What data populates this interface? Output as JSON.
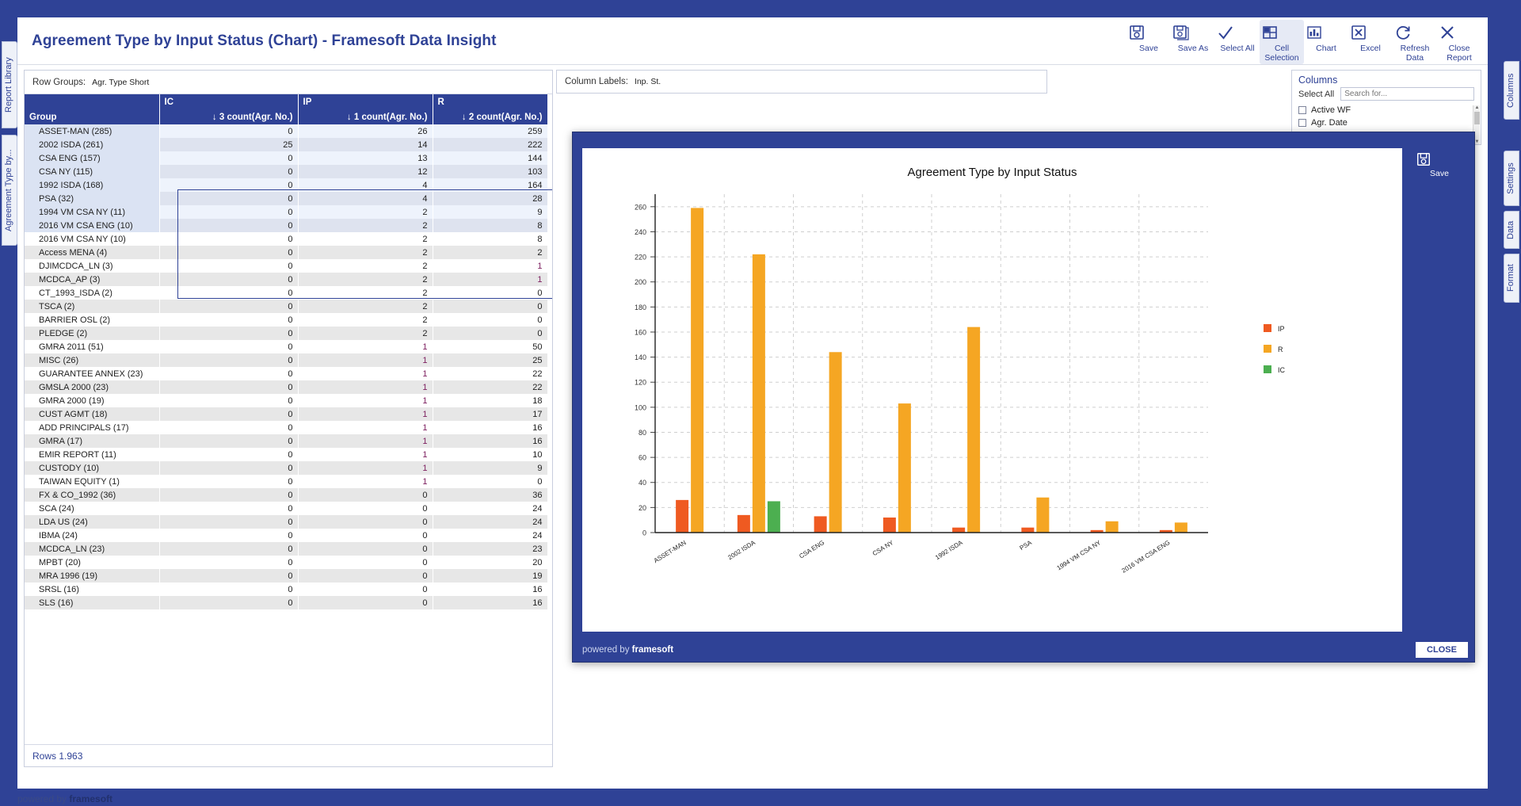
{
  "window": {
    "title": "Agreement Type by Input Status (Chart) - Framesoft Data Insight",
    "footer_powered": "powered by ",
    "footer_brand": "framesoft"
  },
  "vertical_tabs": {
    "left": [
      {
        "label": "Report Library"
      },
      {
        "label": "Agreement Type by..."
      }
    ],
    "right": [
      {
        "label": "Columns"
      },
      {
        "label": "Settings"
      },
      {
        "label": "Data"
      },
      {
        "label": "Format"
      }
    ]
  },
  "toolbar": [
    {
      "label": "Save",
      "icon": "save-icon",
      "active": false
    },
    {
      "label": "Save As",
      "icon": "save-as-icon",
      "active": false
    },
    {
      "label": "Select All",
      "icon": "check-icon",
      "active": false
    },
    {
      "label": "Cell Selection",
      "icon": "grid-icon",
      "active": true
    },
    {
      "label": "Chart",
      "icon": "chart-icon",
      "active": false
    },
    {
      "label": "Excel",
      "icon": "excel-icon",
      "active": false
    },
    {
      "label": "Refresh Data",
      "icon": "refresh-icon",
      "active": false
    },
    {
      "label": "Close Report",
      "icon": "close-icon",
      "active": false
    }
  ],
  "row_groups": {
    "label": "Row Groups:",
    "value": "Agr. Type Short"
  },
  "column_labels": {
    "label": "Column Labels:",
    "value": "Inp. St."
  },
  "columns_panel": {
    "title": "Columns",
    "select_all": "Select All",
    "search_placeholder": "Search for...",
    "items": [
      {
        "label": "Active WF",
        "checked": false
      },
      {
        "label": "Agr. Date",
        "checked": false
      }
    ]
  },
  "grid": {
    "group_headers": [
      "",
      "IC",
      "IP",
      "R"
    ],
    "sub_headers": [
      "Group",
      "↓ 3 count(Agr. No.)",
      "↓ 1 count(Agr. No.)",
      "↓ 2 count(Agr. No.)"
    ],
    "footer": "Rows 1.963",
    "selection": {
      "start_row": 0,
      "end_row": 7
    },
    "rows": [
      {
        "name": "ASSET-MAN (285)",
        "ic": "0",
        "ip": "26",
        "r": "259",
        "sel": true,
        "r_red": false,
        "ip_red": false
      },
      {
        "name": "2002 ISDA (261)",
        "ic": "25",
        "ip": "14",
        "r": "222",
        "sel": true,
        "r_red": false,
        "ip_red": false
      },
      {
        "name": "CSA ENG (157)",
        "ic": "0",
        "ip": "13",
        "r": "144",
        "sel": true,
        "r_red": false,
        "ip_red": false
      },
      {
        "name": "CSA NY (115)",
        "ic": "0",
        "ip": "12",
        "r": "103",
        "sel": true,
        "r_red": false,
        "ip_red": false
      },
      {
        "name": "1992 ISDA (168)",
        "ic": "0",
        "ip": "4",
        "r": "164",
        "sel": true,
        "r_red": false,
        "ip_red": false
      },
      {
        "name": "PSA (32)",
        "ic": "0",
        "ip": "4",
        "r": "28",
        "sel": true,
        "r_red": false,
        "ip_red": false
      },
      {
        "name": "1994 VM CSA NY (11)",
        "ic": "0",
        "ip": "2",
        "r": "9",
        "sel": true,
        "r_red": false,
        "ip_red": false
      },
      {
        "name": "2016 VM CSA ENG (10)",
        "ic": "0",
        "ip": "2",
        "r": "8",
        "sel": true,
        "r_red": false,
        "ip_red": false
      },
      {
        "name": "2016 VM CSA NY (10)",
        "ic": "0",
        "ip": "2",
        "r": "8",
        "sel": false,
        "r_red": false,
        "ip_red": false
      },
      {
        "name": "Access MENA (4)",
        "ic": "0",
        "ip": "2",
        "r": "2",
        "sel": false,
        "r_red": false,
        "ip_red": false
      },
      {
        "name": "DJIMCDCA_LN (3)",
        "ic": "0",
        "ip": "2",
        "r": "1",
        "sel": false,
        "r_red": true,
        "ip_red": false
      },
      {
        "name": "MCDCA_AP (3)",
        "ic": "0",
        "ip": "2",
        "r": "1",
        "sel": false,
        "r_red": true,
        "ip_red": false
      },
      {
        "name": "CT_1993_ISDA (2)",
        "ic": "0",
        "ip": "2",
        "r": "0",
        "sel": false,
        "r_red": false,
        "ip_red": false
      },
      {
        "name": "TSCA (2)",
        "ic": "0",
        "ip": "2",
        "r": "0",
        "sel": false,
        "r_red": false,
        "ip_red": false
      },
      {
        "name": "BARRIER OSL (2)",
        "ic": "0",
        "ip": "2",
        "r": "0",
        "sel": false,
        "r_red": false,
        "ip_red": false
      },
      {
        "name": "PLEDGE (2)",
        "ic": "0",
        "ip": "2",
        "r": "0",
        "sel": false,
        "r_red": false,
        "ip_red": false
      },
      {
        "name": "GMRA 2011 (51)",
        "ic": "0",
        "ip": "1",
        "r": "50",
        "sel": false,
        "r_red": false,
        "ip_red": true
      },
      {
        "name": "MISC (26)",
        "ic": "0",
        "ip": "1",
        "r": "25",
        "sel": false,
        "r_red": false,
        "ip_red": true
      },
      {
        "name": "GUARANTEE ANNEX (23)",
        "ic": "0",
        "ip": "1",
        "r": "22",
        "sel": false,
        "r_red": false,
        "ip_red": true
      },
      {
        "name": "GMSLA 2000 (23)",
        "ic": "0",
        "ip": "1",
        "r": "22",
        "sel": false,
        "r_red": false,
        "ip_red": true
      },
      {
        "name": "GMRA 2000 (19)",
        "ic": "0",
        "ip": "1",
        "r": "18",
        "sel": false,
        "r_red": false,
        "ip_red": true
      },
      {
        "name": "CUST AGMT (18)",
        "ic": "0",
        "ip": "1",
        "r": "17",
        "sel": false,
        "r_red": false,
        "ip_red": true
      },
      {
        "name": "ADD PRINCIPALS (17)",
        "ic": "0",
        "ip": "1",
        "r": "16",
        "sel": false,
        "r_red": false,
        "ip_red": true
      },
      {
        "name": "GMRA (17)",
        "ic": "0",
        "ip": "1",
        "r": "16",
        "sel": false,
        "r_red": false,
        "ip_red": true
      },
      {
        "name": "EMIR REPORT (11)",
        "ic": "0",
        "ip": "1",
        "r": "10",
        "sel": false,
        "r_red": false,
        "ip_red": true
      },
      {
        "name": "CUSTODY (10)",
        "ic": "0",
        "ip": "1",
        "r": "9",
        "sel": false,
        "r_red": false,
        "ip_red": true
      },
      {
        "name": "TAIWAN EQUITY (1)",
        "ic": "0",
        "ip": "1",
        "r": "0",
        "sel": false,
        "r_red": false,
        "ip_red": true
      },
      {
        "name": "FX & CO_1992 (36)",
        "ic": "0",
        "ip": "0",
        "r": "36",
        "sel": false,
        "r_red": false,
        "ip_red": false
      },
      {
        "name": "SCA (24)",
        "ic": "0",
        "ip": "0",
        "r": "24",
        "sel": false,
        "r_red": false,
        "ip_red": false
      },
      {
        "name": "LDA US (24)",
        "ic": "0",
        "ip": "0",
        "r": "24",
        "sel": false,
        "r_red": false,
        "ip_red": false
      },
      {
        "name": "IBMA (24)",
        "ic": "0",
        "ip": "0",
        "r": "24",
        "sel": false,
        "r_red": false,
        "ip_red": false
      },
      {
        "name": "MCDCA_LN (23)",
        "ic": "0",
        "ip": "0",
        "r": "23",
        "sel": false,
        "r_red": false,
        "ip_red": false
      },
      {
        "name": "MPBT (20)",
        "ic": "0",
        "ip": "0",
        "r": "20",
        "sel": false,
        "r_red": false,
        "ip_red": false
      },
      {
        "name": "MRA 1996 (19)",
        "ic": "0",
        "ip": "0",
        "r": "19",
        "sel": false,
        "r_red": false,
        "ip_red": false
      },
      {
        "name": "SRSL (16)",
        "ic": "0",
        "ip": "0",
        "r": "16",
        "sel": false,
        "r_red": false,
        "ip_red": false
      },
      {
        "name": "SLS (16)",
        "ic": "0",
        "ip": "0",
        "r": "16",
        "sel": false,
        "r_red": false,
        "ip_red": false
      }
    ]
  },
  "dialog": {
    "save_label": "Save",
    "close_label": "CLOSE",
    "powered": "powered by ",
    "brand": "framesoft"
  },
  "chart_data": {
    "type": "bar",
    "title": "Agreement Type by Input Status",
    "xlabel": "",
    "ylabel": "",
    "ylim": [
      0,
      270
    ],
    "yticks": [
      0,
      20,
      40,
      60,
      80,
      100,
      120,
      140,
      160,
      180,
      200,
      220,
      240,
      260
    ],
    "grid": true,
    "legend_position": "right",
    "categories": [
      "ASSET-MAN",
      "2002 ISDA",
      "CSA ENG",
      "CSA NY",
      "1992 ISDA",
      "PSA",
      "1994 VM CSA NY",
      "2016 VM CSA ENG"
    ],
    "series": [
      {
        "name": "IP",
        "color": "#ef5a21",
        "values": [
          26,
          14,
          13,
          12,
          4,
          4,
          2,
          2
        ]
      },
      {
        "name": "R",
        "color": "#f5a623",
        "values": [
          259,
          222,
          144,
          103,
          164,
          28,
          9,
          8
        ]
      },
      {
        "name": "IC",
        "color": "#4caf50",
        "values": [
          0,
          25,
          0,
          0,
          0,
          0,
          0,
          0
        ]
      }
    ]
  }
}
